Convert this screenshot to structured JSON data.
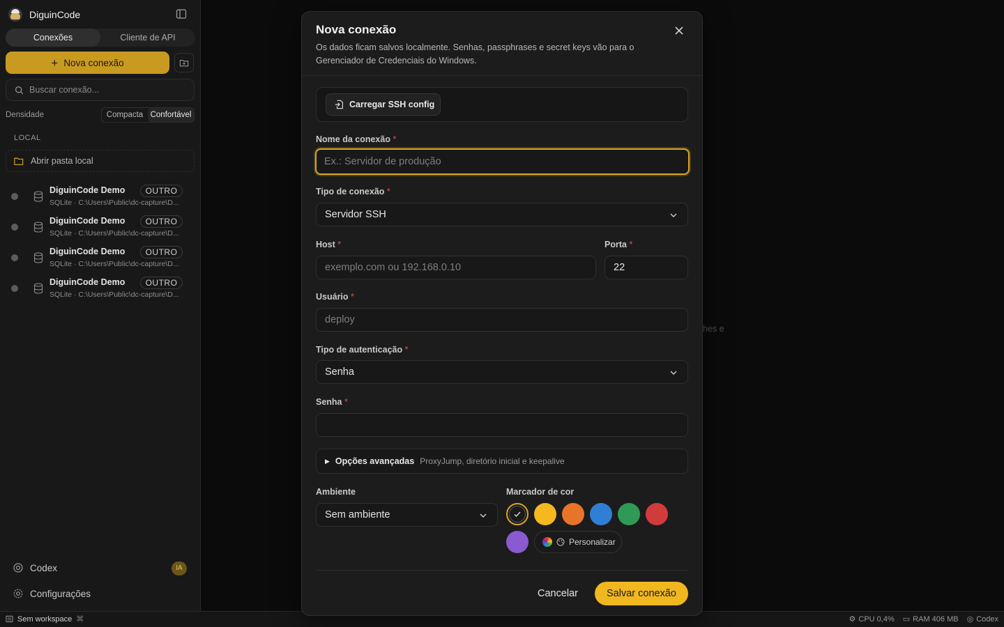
{
  "app": {
    "name": "DiguinCode"
  },
  "sidebar": {
    "tabs": [
      {
        "label": "Conexões",
        "active": true
      },
      {
        "label": "Cliente de API",
        "active": false
      }
    ],
    "new_connection_label": "Nova conexão",
    "search_placeholder": "Buscar conexão...",
    "density": {
      "label": "Densidade",
      "options": [
        "Compacta",
        "Confortável"
      ],
      "selected": "Confortável"
    },
    "section_local": "LOCAL",
    "open_local_folder": "Abrir pasta local",
    "connections": [
      {
        "name": "DiguinCode Demo",
        "badge": "OUTRO",
        "path": "SQLite · C:\\Users\\Public\\dc-capture\\D..."
      },
      {
        "name": "DiguinCode Demo",
        "badge": "OUTRO",
        "path": "SQLite · C:\\Users\\Public\\dc-capture\\D..."
      },
      {
        "name": "DiguinCode Demo",
        "badge": "OUTRO",
        "path": "SQLite · C:\\Users\\Public\\dc-capture\\D..."
      },
      {
        "name": "DiguinCode Demo",
        "badge": "OUTRO",
        "path": "SQLite · C:\\Users\\Public\\dc-capture\\D..."
      }
    ],
    "codex_label": "Codex",
    "ia_badge": "IA",
    "settings_label": "Configurações"
  },
  "statusbar": {
    "workspace": "Sem workspace",
    "cpu": "CPU 0,4%",
    "ram": "RAM 406 MB",
    "codex": "Codex"
  },
  "background": {
    "partial_text": "hes e"
  },
  "modal": {
    "title": "Nova conexão",
    "description": "Os dados ficam salvos localmente. Senhas, passphrases e secret keys vão para o Gerenciador de Credenciais do Windows.",
    "load_ssh_config": "Carregar SSH config",
    "connection_name": {
      "label": "Nome da conexão",
      "placeholder": "Ex.: Servidor de produção",
      "value": ""
    },
    "connection_type": {
      "label": "Tipo de conexão",
      "value": "Servidor SSH"
    },
    "host": {
      "label": "Host",
      "placeholder": "exemplo.com ou 192.168.0.10",
      "value": ""
    },
    "port": {
      "label": "Porta",
      "value": "22"
    },
    "user": {
      "label": "Usuário",
      "placeholder": "deploy",
      "value": ""
    },
    "auth_type": {
      "label": "Tipo de autenticação",
      "value": "Senha"
    },
    "password": {
      "label": "Senha",
      "value": ""
    },
    "required_mark": "*",
    "advanced": {
      "label": "Opções avançadas",
      "hint": "ProxyJump, diretório inicial e keepalive"
    },
    "environment": {
      "label": "Ambiente",
      "value": "Sem ambiente"
    },
    "color_marker": {
      "label": "Marcador de cor",
      "colors": [
        "none",
        "#f5b820",
        "#e8742a",
        "#2f7fd6",
        "#2f9a55",
        "#d23b3b",
        "#8a5ad0"
      ],
      "selected": "none",
      "customize_label": "Personalizar"
    },
    "cancel_label": "Cancelar",
    "save_label": "Salvar conexão"
  },
  "colors": {
    "accent": "#f0b81e",
    "sidebar_button": "#c99a20",
    "required": "#e0534d"
  }
}
